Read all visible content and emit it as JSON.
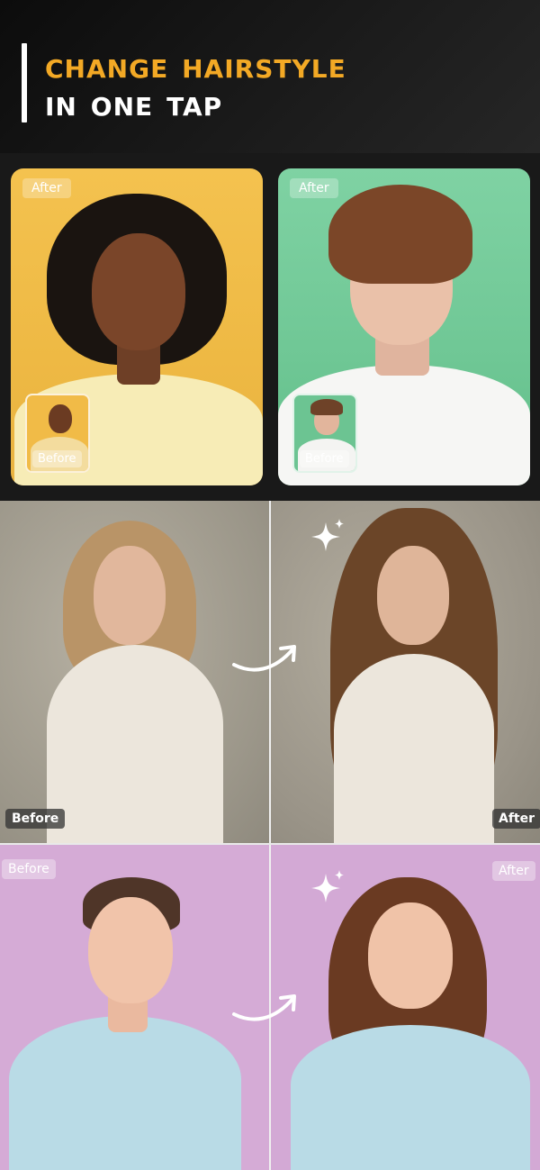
{
  "header": {
    "title_line1": "Change Hairstyle",
    "title_line2": "in one tap",
    "accent_color": "#f3a925"
  },
  "cards": [
    {
      "after_label": "After",
      "before_label": "Before"
    },
    {
      "after_label": "After",
      "before_label": "Before"
    }
  ],
  "comparisons": [
    {
      "before_label": "Before",
      "after_label": "After",
      "icons": [
        "sparkle-icon",
        "arrow-right-icon"
      ]
    },
    {
      "before_label": "Before",
      "after_label": "After",
      "icons": [
        "sparkle-icon",
        "arrow-right-icon"
      ]
    }
  ]
}
